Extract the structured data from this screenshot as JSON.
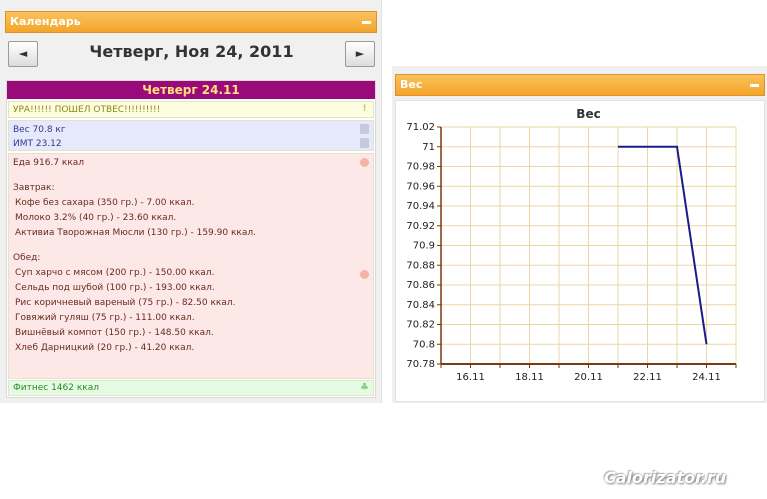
{
  "calendar": {
    "panel_title": "Календарь",
    "prev_label": "◄",
    "next_label": "►",
    "date_title": "Четверг, Ноя 24, 2011"
  },
  "day": {
    "header": "Четверг 24.11",
    "note": "УРА!!!!!! ПОШЕЛ ОТВЕС!!!!!!!!!!",
    "weight_line": "Вес 70.8 кг",
    "bmi_line": "ИМТ 23.12",
    "food_total": "Еда 916.7 ккал",
    "meals": [
      {
        "title": "Завтрак:",
        "items": [
          "Кофе без сахара (350 гр.) - 7.00 ккал.",
          "Молоко 3.2% (40 гр.) - 23.60 ккал.",
          "Активиа Творожная Мюсли (130 гр.) - 159.90 ккал."
        ]
      },
      {
        "title": "Обед:",
        "items": [
          "Суп харчо с мясом (200 гр.) - 150.00 ккал.",
          "Сельдь под шубой (100 гр.) - 193.00 ккал.",
          "Рис коричневый вареный (75 гр.) - 82.50 ккал.",
          "Говяжий гуляш (75 гр.) - 111.00 ккал.",
          "Вишнёвый компот (150 гр.) - 148.50 ккал.",
          "Хлеб Дарницкий (20 гр.) - 41.20 ккал."
        ]
      }
    ],
    "fitness": "Фитнес 1462 ккал"
  },
  "weight_panel": {
    "panel_title": "Вес"
  },
  "chart_data": {
    "type": "line",
    "title": "Вес",
    "xlabel": "",
    "ylabel": "",
    "x_ticks": [
      "16.11",
      "18.11",
      "20.11",
      "22.11",
      "24.11"
    ],
    "y_ticks": [
      "71.02",
      "71",
      "70.98",
      "70.96",
      "70.94",
      "70.92",
      "70.9",
      "70.88",
      "70.86",
      "70.84",
      "70.82",
      "70.8",
      "70.78"
    ],
    "xlim": [
      "15.11",
      "25.11"
    ],
    "ylim": [
      70.78,
      71.02
    ],
    "series": [
      {
        "x": [
          "21.11",
          "23.11",
          "24.11"
        ],
        "values": [
          71,
          71,
          70.8
        ]
      }
    ],
    "grid": true,
    "colors": {
      "line": "#1a1a8a",
      "grid": "#ead8a0",
      "axis": "#7a3a10"
    }
  },
  "watermark": "Calorizator.ru"
}
